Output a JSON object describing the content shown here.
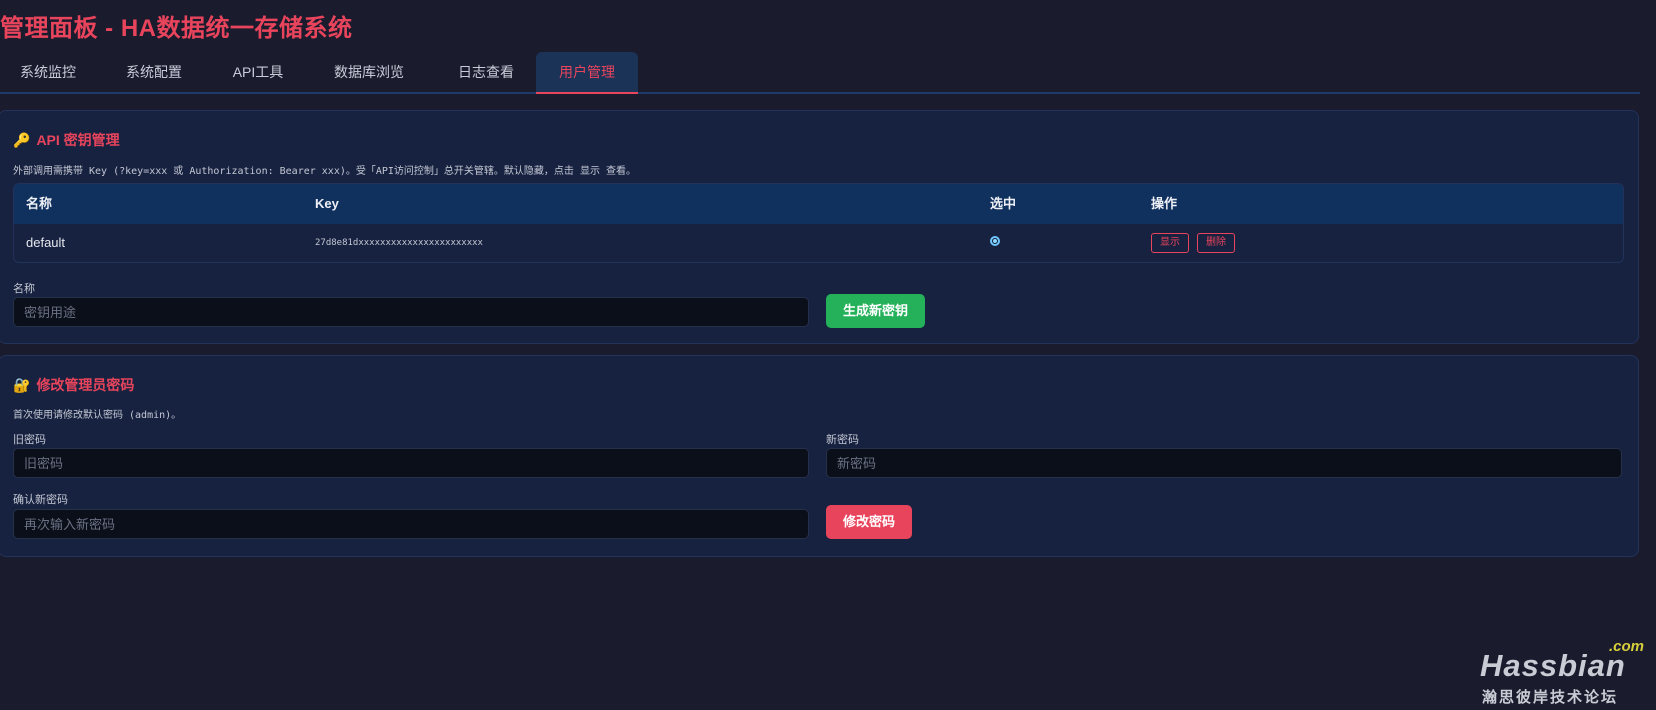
{
  "header": {
    "title": "管理面板 - HA数据统一存储系统"
  },
  "tabs": [
    {
      "label": "系统监控"
    },
    {
      "label": "系统配置"
    },
    {
      "label": "API工具"
    },
    {
      "label": "数据库浏览"
    },
    {
      "label": "日志查看"
    },
    {
      "label": "用户管理",
      "active": true
    }
  ],
  "api_keys": {
    "title": "API 密钥管理",
    "icon": "key-icon",
    "hint": "外部调用需携带 Key (?key=xxx 或 Authorization: Bearer xxx)。受「API访问控制」总开关管辖。默认隐藏，点击 显示 查看。",
    "columns": [
      "名称",
      "Key",
      "选中",
      "操作"
    ],
    "rows": [
      {
        "name": "default",
        "key": "27d8e81dxxxxxxxxxxxxxxxxxxxxxxx",
        "selected": true,
        "show_label": "显示",
        "delete_label": "删除"
      }
    ],
    "name_label": "名称",
    "name_placeholder": "密钥用途",
    "generate_label": "生成新密钥"
  },
  "password": {
    "title": "修改管理员密码",
    "icon": "lock-icon",
    "hint": "首次使用请修改默认密码 (admin)。",
    "old_label": "旧密码",
    "old_placeholder": "旧密码",
    "new_label": "新密码",
    "new_placeholder": "新密码",
    "confirm_label": "确认新密码",
    "confirm_placeholder": "再次输入新密码",
    "submit_label": "修改密码"
  },
  "watermark": {
    "com": ".com",
    "main": "Hassbian",
    "sub": "瀚思彼岸技术论坛"
  },
  "colors": {
    "accent": "#e8445c",
    "success": "#24b15a",
    "background": "#1b1b2e",
    "card": "#172240",
    "table_header": "#10305e"
  }
}
